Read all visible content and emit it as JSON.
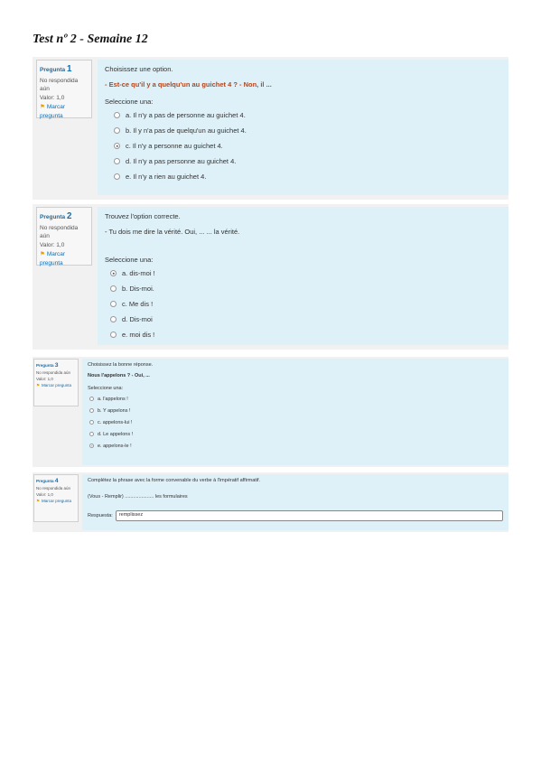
{
  "doc_title": "Test nº 2 - Semaine 12",
  "questions": [
    {
      "label": "Pregunta",
      "number": "1",
      "status": "No respondida aún",
      "points": "Valor: 1,0",
      "flag_label": "Marcar pregunta",
      "stem": "Choisissez une option.",
      "text": "- Est-ce qu'il y a quelqu'un au guichet 4 ? - Non, il ...",
      "select_label": "Seleccione una:",
      "options": [
        {
          "text": "a. Il n'y a pas de personne au guichet 4.",
          "checked": false
        },
        {
          "text": "b. Il y n'a pas de quelqu'un au guichet 4.",
          "checked": false
        },
        {
          "text": "c. Il n'y a personne au guichet 4.",
          "checked": true
        },
        {
          "text": "d. Il n'y a pas personne au guichet 4.",
          "checked": false
        },
        {
          "text": "e. Il n'y a rien au guichet 4.",
          "checked": false
        }
      ]
    },
    {
      "label": "Pregunta",
      "number": "2",
      "status": "No respondida aún",
      "points": "Valor: 1,0",
      "flag_label": "Marcar pregunta",
      "stem": "Trouvez l'option correcte.",
      "text": "- Tu dois me dire la vérité. Oui, ... ... la vérité.",
      "select_label": "Seleccione una:",
      "options": [
        {
          "text": "a. dis-moi !",
          "checked": true
        },
        {
          "text": "b. Dis-moi.",
          "checked": false
        },
        {
          "text": "c. Me dis !",
          "checked": false
        },
        {
          "text": "d. Dis-moi",
          "checked": false
        },
        {
          "text": "e. moi dis !",
          "checked": false
        }
      ]
    },
    {
      "label": "Pregunta",
      "number": "3",
      "status": "No respondida aún",
      "points": "Valor: 1,0",
      "flag_label": "Marcar pregunta",
      "stem": "Choisissez la bonne réponse.",
      "text": "Nous l'appelons ? - Oui, ...",
      "select_label": "Seleccione una:",
      "options": [
        {
          "text": "a. l'appelons !",
          "checked": false
        },
        {
          "text": "b. Y appelons !",
          "checked": false
        },
        {
          "text": "c. appelons-lui !",
          "checked": false
        },
        {
          "text": "d. Le appelons !",
          "checked": false
        },
        {
          "text": "e. appelons-le !",
          "checked": true
        }
      ]
    },
    {
      "label": "Pregunta",
      "number": "4",
      "status": "No respondida aún",
      "points": "Valor: 1,0",
      "flag_label": "Marcar pregunta",
      "stem": "Complétez la phrase avec la forme convenable du verbe à l'impératif affirmatif.",
      "text": "(Vous - Remplir) ..................... les formulaires",
      "answer_label": "Respuesta:",
      "answer_value": "remplissez"
    }
  ]
}
